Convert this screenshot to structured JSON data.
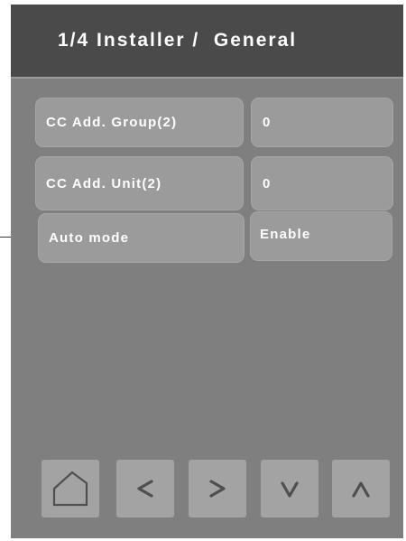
{
  "header": {
    "title": "1/4 Installer /  General"
  },
  "settings": [
    {
      "label": "CC Add. Group(2)",
      "value": "0"
    },
    {
      "label": "CC Add. Unit(2)",
      "value": "0"
    },
    {
      "label": "Auto mode",
      "value": "Enable"
    }
  ],
  "nav": {
    "buttons": [
      {
        "icon": "home-icon"
      },
      {
        "icon": "chevron-left-icon"
      },
      {
        "icon": "chevron-right-icon"
      },
      {
        "icon": "chevron-down-icon"
      },
      {
        "icon": "chevron-up-icon"
      }
    ]
  },
  "colors": {
    "screen_bg": "#7f7f7f",
    "header_bg": "#4a4a4a",
    "pill_bg": "#9b9b9b",
    "nav_button_bg": "#a3a3a3",
    "icon_color": "#4f4f4f",
    "text": "#ffffff"
  }
}
